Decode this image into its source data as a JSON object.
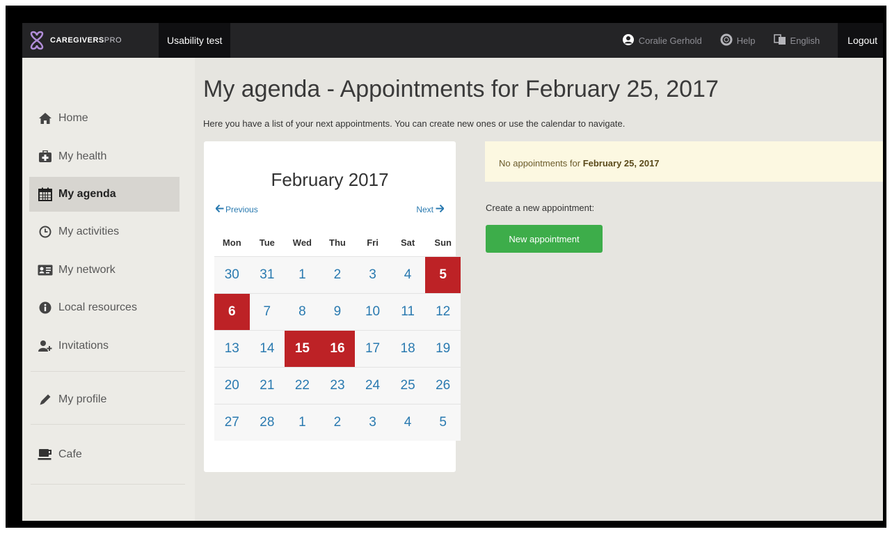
{
  "navbar": {
    "brand_main": "CAREGIVERS",
    "brand_pro": "PRO",
    "project": "Usability test",
    "user_name": "Coralie Gerhold",
    "help": "Help",
    "language": "English",
    "logout": "Logout"
  },
  "sidebar": {
    "items": [
      {
        "label": "Home",
        "icon": "home-icon"
      },
      {
        "label": "My health",
        "icon": "medkit-icon"
      },
      {
        "label": "My agenda",
        "icon": "calendar-icon",
        "active": true
      },
      {
        "label": "My activities",
        "icon": "clock-icon"
      },
      {
        "label": "My network",
        "icon": "contact-card-icon"
      },
      {
        "label": "Local resources",
        "icon": "info-icon"
      },
      {
        "label": "Invitations",
        "icon": "add-user-icon"
      },
      {
        "label": "My profile",
        "icon": "pencil-icon"
      },
      {
        "label": "Cafe",
        "icon": "coffee-icon"
      }
    ]
  },
  "main": {
    "title": "My agenda - Appointments for February 25, 2017",
    "subtitle": "Here you have a list of your next appointments. You can create new ones or use the calendar to navigate.",
    "alert_prefix": "No appointments for ",
    "alert_date": "February 25, 2017",
    "create_label": "Create a new appointment:",
    "new_button": "New appointment"
  },
  "calendar": {
    "month_title": "February 2017",
    "previous": "Previous",
    "next": "Next",
    "weekdays": [
      "Mon",
      "Tue",
      "Wed",
      "Thu",
      "Fri",
      "Sat",
      "Sun"
    ],
    "weeks": [
      [
        "30",
        "31",
        "1",
        "2",
        "3",
        "4",
        "5"
      ],
      [
        "6",
        "7",
        "8",
        "9",
        "10",
        "11",
        "12"
      ],
      [
        "13",
        "14",
        "15",
        "16",
        "17",
        "18",
        "19"
      ],
      [
        "20",
        "21",
        "22",
        "23",
        "24",
        "25",
        "26"
      ],
      [
        "27",
        "28",
        "1",
        "2",
        "3",
        "4",
        "5"
      ]
    ],
    "highlighted_color": "#bd2226"
  }
}
